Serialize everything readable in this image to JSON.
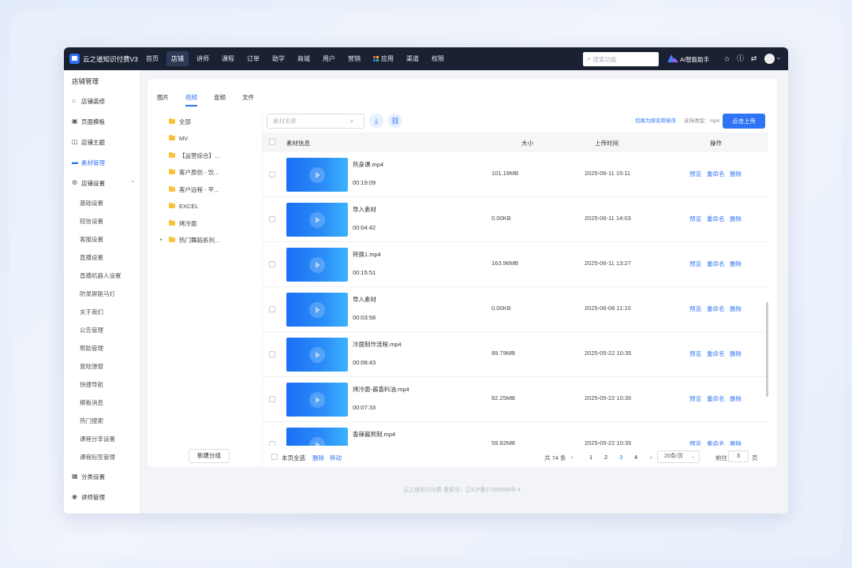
{
  "app": {
    "title": "云之道知识付费V3"
  },
  "nav": {
    "items": [
      "首页",
      "店铺",
      "讲师",
      "课程",
      "订单",
      "助学",
      "商城",
      "用户",
      "营销",
      "应用",
      "渠道",
      "权限"
    ],
    "active_index": 1
  },
  "top_search": {
    "placeholder": "搜索功能"
  },
  "ai_assistant": {
    "label": "AI智能助手"
  },
  "sidebar": {
    "title": "店铺管理",
    "items": [
      {
        "label": "店铺装修",
        "icon": "storefront-icon"
      },
      {
        "label": "页面模板",
        "icon": "template-icon"
      },
      {
        "label": "店铺主题",
        "icon": "theme-icon"
      },
      {
        "label": "素材管理",
        "icon": "folder-icon"
      },
      {
        "label": "店铺设置",
        "icon": "gear-icon"
      }
    ],
    "sub_items": [
      "基础设置",
      "短信设置",
      "客服设置",
      "直播设置",
      "直播机器人设置",
      "防录屏跑马灯",
      "关于我们",
      "公告管理",
      "帮助管理",
      "登陆弹窗",
      "快捷导航",
      "模板消息",
      "热门搜索",
      "课程分享设置",
      "课程标签管理"
    ],
    "bottom_items": [
      {
        "label": "分类设置",
        "icon": "category-icon"
      },
      {
        "label": "讲师管理",
        "icon": "teacher-icon"
      }
    ]
  },
  "tabs": [
    "图片",
    "视频",
    "音频",
    "文件"
  ],
  "active_tab": 1,
  "folders": [
    "全部",
    "MV",
    "【运营综合】...",
    "客户原创 - 饮...",
    "客户远程 - 平...",
    "EXCEL",
    "烤冷面",
    "热门舞蹈系列..."
  ],
  "new_group_label": "新建分组",
  "material_search": {
    "placeholder": "素材名称"
  },
  "toolbar": {
    "sort_link": "切换为按名称排序",
    "support_type": "支持类型：mp4",
    "upload_label": "点击上传"
  },
  "table": {
    "headers": [
      "素材信息",
      "大小",
      "上传时间",
      "操作"
    ],
    "actions": [
      "预览",
      "重命名",
      "删除"
    ],
    "rows": [
      {
        "name": "热身课.mp4",
        "duration": "00:19:09",
        "size": "101.19MB",
        "time": "2025-06-11 15:11"
      },
      {
        "name": "导入素材",
        "duration": "00:04:42",
        "size": "0.00KB",
        "time": "2025-06-11 14:03"
      },
      {
        "name": "转换1.mp4",
        "duration": "00:15:51",
        "size": "163.96MB",
        "time": "2025-06-11 13:27"
      },
      {
        "name": "导入素材",
        "duration": "00:03:58",
        "size": "0.00KB",
        "time": "2025-06-08 11:10"
      },
      {
        "name": "冷面制作流程.mp4",
        "duration": "00:08:43",
        "size": "89.79MB",
        "time": "2025-05-22 10:35"
      },
      {
        "name": "烤冷面-酱香料油.mp4",
        "duration": "00:07:33",
        "size": "82.25MB",
        "time": "2025-05-22 10:35"
      },
      {
        "name": "香辣酱熬制.mp4",
        "duration": "",
        "size": "59.82MB",
        "time": "2025-05-22 10:35"
      }
    ]
  },
  "footer": {
    "select_all": "本页全选",
    "delete": "删除",
    "move": "移动",
    "total": "共 74 条",
    "pages": [
      "1",
      "2",
      "3",
      "4"
    ],
    "current_page": "3",
    "per_page": "20条/页",
    "goto_label": "前往",
    "goto_value": "3",
    "page_unit": "页"
  },
  "copyright": "云之道知识付费  备案号：辽ICP备17006698号-4",
  "colors": {
    "accent": "#2f74f5",
    "topbar": "#1a2133",
    "folder": "#f8c33c"
  }
}
